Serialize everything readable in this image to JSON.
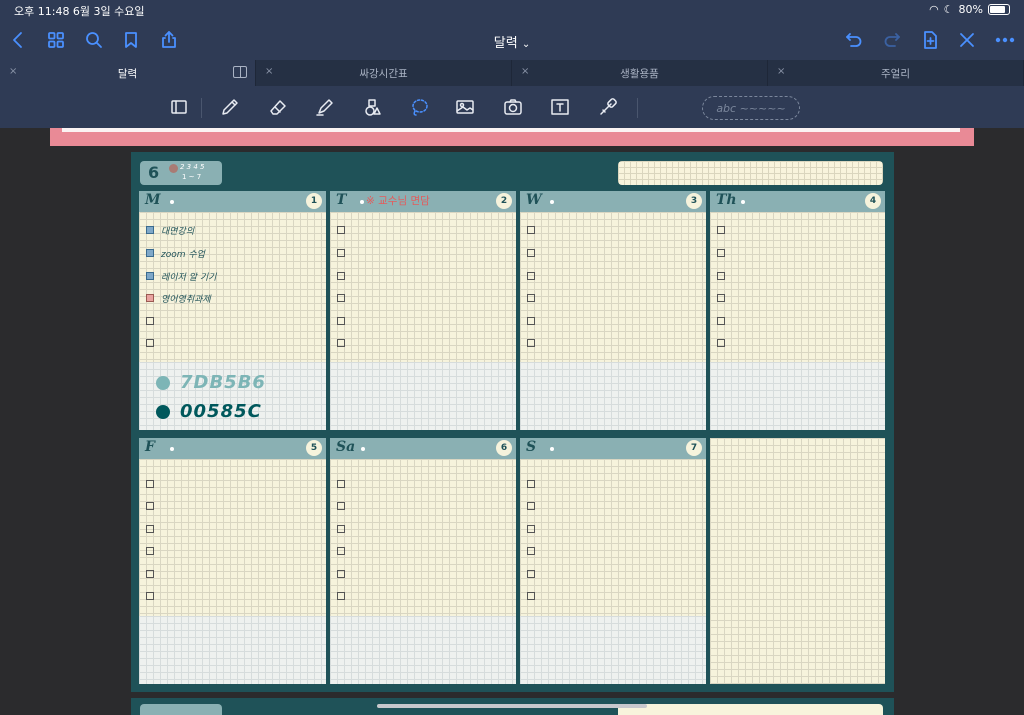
{
  "status_bar": {
    "time_date": "오후 11:48   6월 3일 수요일",
    "battery": "80%"
  },
  "nav": {
    "title": "달력",
    "title_chevron": "⌄",
    "left_icons": [
      "back-icon",
      "grid-icon",
      "search-icon",
      "bookmark-icon",
      "share-icon"
    ],
    "right_icons": [
      "undo-icon",
      "redo-icon",
      "add-page-icon",
      "close-icon",
      "more-icon"
    ]
  },
  "tabs": [
    {
      "label": "달력",
      "active": true
    },
    {
      "label": "싸강시간표",
      "active": false
    },
    {
      "label": "생활용품",
      "active": false
    },
    {
      "label": "주얼리",
      "active": false
    }
  ],
  "tab_close": "×",
  "tools": {
    "shape_placeholder": "abc ~~~~~",
    "accent_color": "#4a90ff"
  },
  "planner": {
    "month": "6",
    "weeks_top": "2 3 4 5",
    "weeks_bottom": "1 ~ 7",
    "days": [
      {
        "label": "M",
        "num": "1"
      },
      {
        "label": "T",
        "num": "2",
        "note": "※ 교수님 면담"
      },
      {
        "label": "W",
        "num": "3"
      },
      {
        "label": "Th",
        "num": "4"
      },
      {
        "label": "F",
        "num": "5"
      },
      {
        "label": "Sa",
        "num": "6"
      },
      {
        "label": "S",
        "num": "7"
      }
    ],
    "monday_tasks": [
      "대면강의",
      "zoom 수업",
      "레이저 알 기기",
      "영어영취과제"
    ],
    "swatches": [
      {
        "hex": "7DB5B6",
        "color": "#7db5b6"
      },
      {
        "hex": "00585C",
        "color": "#00585c"
      }
    ]
  }
}
